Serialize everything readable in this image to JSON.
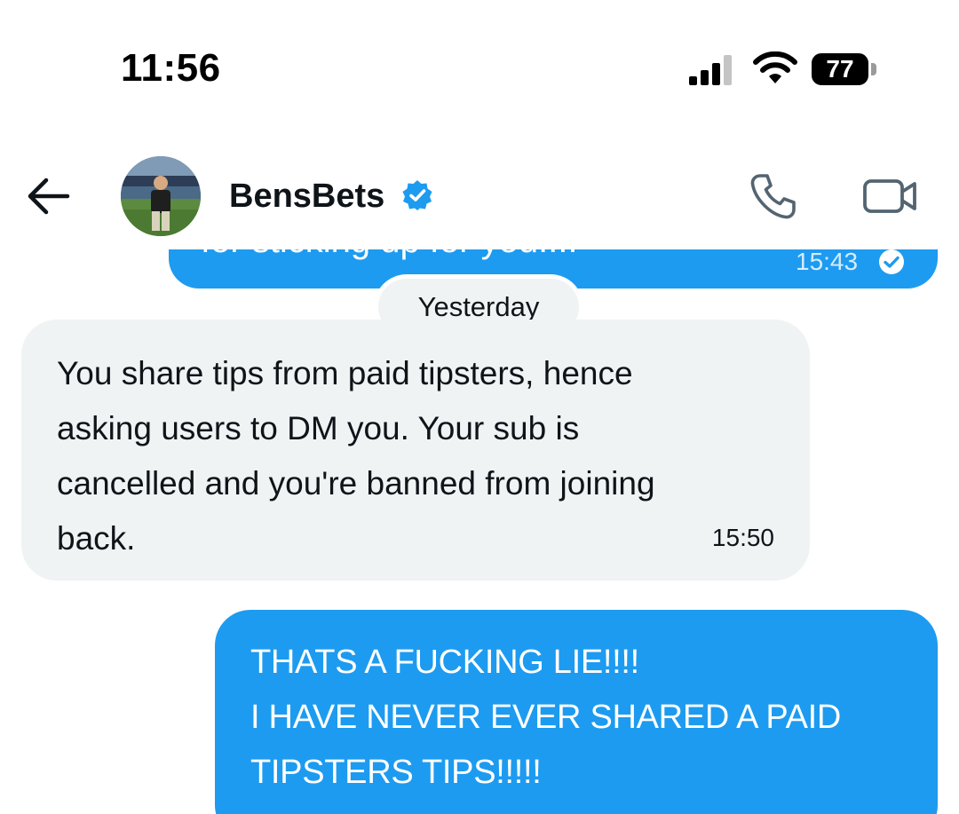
{
  "status_bar": {
    "time": "11:56",
    "battery_level": "77",
    "icons": [
      "signal-icon",
      "wifi-icon",
      "battery-icon"
    ]
  },
  "header": {
    "contact_name": "BensBets",
    "verified": true,
    "icons": [
      "back-arrow-icon",
      "verified-badge-icon",
      "phone-icon",
      "video-camera-icon"
    ]
  },
  "conversation": {
    "previous_outgoing": {
      "text_partial": "for sticking up for you!!!!",
      "time": "15:43",
      "status_icon": "read-check-icon"
    },
    "date_separator": "Yesterday",
    "incoming_message": {
      "lines": [
        "You share tips from paid tipsters, hence",
        "asking users to DM you. Your sub is",
        "cancelled and you're banned from joining",
        "back."
      ],
      "time": "15:50"
    },
    "outgoing_message": {
      "lines": [
        "THATS A FUCKING LIE!!!!",
        "I HAVE NEVER EVER SHARED A PAID",
        "TIPSTERS TIPS!!!!!"
      ]
    }
  },
  "colors": {
    "outgoing_bubble": "#1d9bf0",
    "incoming_bubble": "#eff3f4",
    "verified_badge": "#1d9bf0",
    "text_primary": "#0f1419"
  }
}
